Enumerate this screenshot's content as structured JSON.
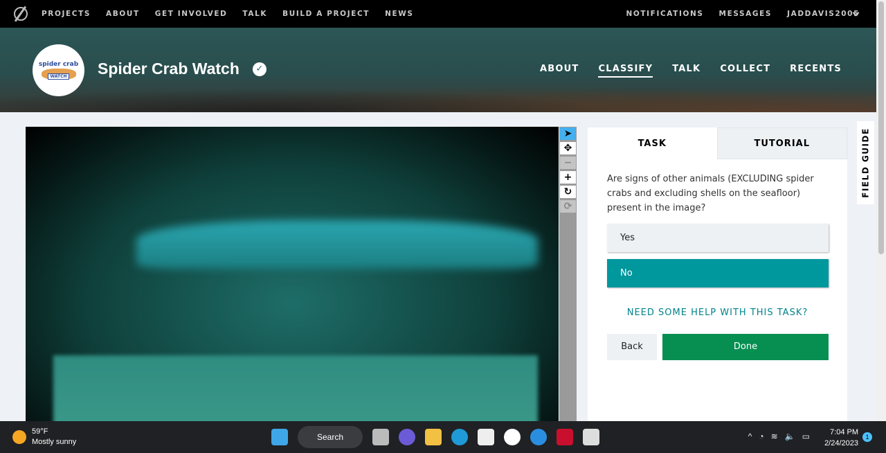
{
  "topnav": {
    "links": [
      "PROJECTS",
      "ABOUT",
      "GET INVOLVED",
      "TALK",
      "BUILD A PROJECT",
      "NEWS"
    ],
    "right": [
      "NOTIFICATIONS",
      "MESSAGES",
      "JADDAVIS2005"
    ]
  },
  "project": {
    "title": "Spider Crab Watch",
    "logo_text_1": "spider crab",
    "logo_text_2": "WATCH",
    "nav": [
      "ABOUT",
      "CLASSIFY",
      "TALK",
      "COLLECT",
      "RECENTS"
    ]
  },
  "toolbar": {
    "icons": [
      "pointer-icon",
      "move-icon",
      "zoom-out-icon",
      "zoom-in-icon",
      "rotate-icon",
      "reset-icon"
    ]
  },
  "task": {
    "tabs": [
      "TASK",
      "TUTORIAL"
    ],
    "question": "Are signs of other animals (EXCLUDING spider crabs and excluding shells on the seafloor) present in the image?",
    "answers": [
      "Yes",
      "No"
    ],
    "selected": "No",
    "help": "NEED SOME HELP WITH THIS TASK?",
    "back": "Back",
    "done": "Done"
  },
  "field_guide": "FIELD GUIDE",
  "taskbar": {
    "temp": "59°F",
    "weather": "Mostly sunny",
    "search": "Search",
    "time": "7:04 PM",
    "date": "2/24/2023",
    "notif_count": "1"
  },
  "colors": {
    "accent": "#00979d",
    "done": "#078f52"
  }
}
